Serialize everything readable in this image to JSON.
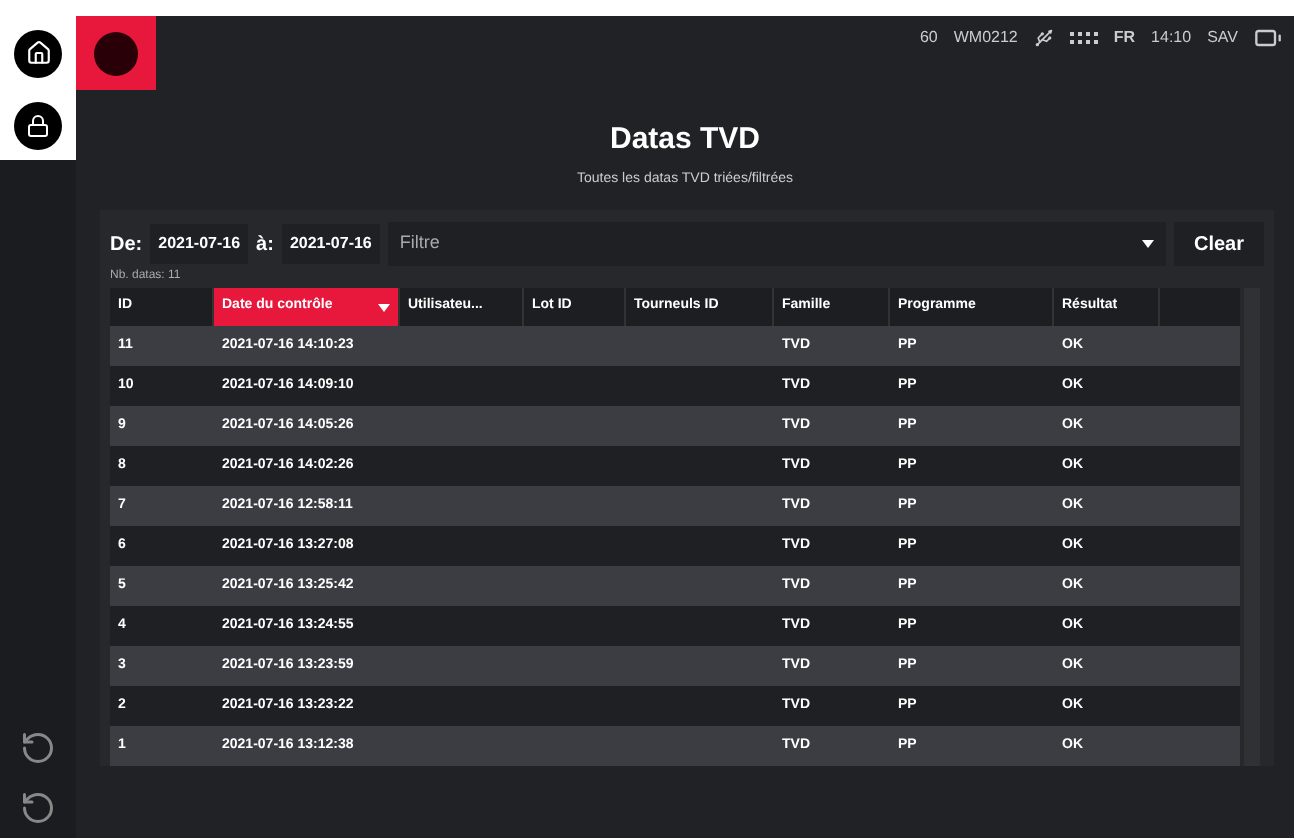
{
  "status_bar": {
    "items": [
      "60",
      "WM0212"
    ],
    "language": "FR",
    "time": "14:10",
    "user": "SAV"
  },
  "header": {
    "title": "Datas TVD",
    "subtitle": "Toutes les datas TVD triées/filtrées"
  },
  "filter_bar": {
    "from_label": "De:",
    "from_value": "2021-07-16",
    "to_label": "à:",
    "to_value": "2021-07-16",
    "filter_placeholder": "Filtre",
    "clear_button": "Clear"
  },
  "count": "Nb. datas: 11",
  "table": {
    "columns": [
      {
        "label": "ID",
        "sorted": false
      },
      {
        "label": "Date du contrôle",
        "sorted": true
      },
      {
        "label": "Utilisateu...",
        "sorted": false
      },
      {
        "label": "Lot ID",
        "sorted": false
      },
      {
        "label": "Tourneuls ID",
        "sorted": false
      },
      {
        "label": "Famille",
        "sorted": false
      },
      {
        "label": "Programme",
        "sorted": false
      },
      {
        "label": "Résultat",
        "sorted": false
      }
    ],
    "rows": [
      [
        "11",
        "2021-07-16 14:10:23",
        "TVD",
        "PP",
        "OK"
      ],
      [
        "10",
        "2021-07-16 14:09:10",
        "TVD",
        "PP",
        "OK"
      ],
      [
        "9",
        "2021-07-16 14:05:26",
        "TVD",
        "PP",
        "OK"
      ],
      [
        "8",
        "2021-07-16 14:02:26",
        "TVD",
        "PP",
        "OK"
      ],
      [
        "7",
        "2021-07-16 12:58:11",
        "TVD",
        "PP",
        "OK"
      ],
      [
        "6",
        "2021-07-16 13:27:08",
        "TVD",
        "PP",
        "OK"
      ],
      [
        "5",
        "2021-07-16 13:25:42",
        "TVD",
        "PP",
        "OK"
      ],
      [
        "4",
        "2021-07-16 13:24:55",
        "TVD",
        "PP",
        "OK"
      ],
      [
        "3",
        "2021-07-16 13:23:59",
        "TVD",
        "PP",
        "OK"
      ],
      [
        "2",
        "2021-07-16 13:23:22",
        "TVD",
        "PP",
        "OK"
      ],
      [
        "1",
        "2021-07-16 13:12:38",
        "TVD",
        "PP",
        "OK"
      ]
    ]
  }
}
